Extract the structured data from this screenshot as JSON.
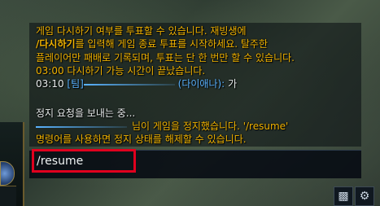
{
  "chat": {
    "lines": [
      {
        "text": "게임 다시하기 여부를 투표할 수 있습니다. 재빙생에"
      },
      {
        "cmd": "/다시하기",
        "text": "를 입력해 게임 종료 투표를 시작하세요. 탈주한"
      },
      {
        "text": "플레이어만 패배로 기록되며, 투표는 단 한 번만 할 수 있습니다."
      },
      {
        "text": "03:00 다시하기 가능 시간이 끝났습니다."
      },
      {
        "time": "03:10",
        "channel": "[팀]",
        "champion": "(다이애나):",
        "message": "가"
      },
      {
        "text": "정지 요청을 보내는 중..."
      },
      {
        "text": "님이 게임을 정지했습니다. '/resume'"
      },
      {
        "text": "명령어를 사용하면 정지 상태를 해제할 수 있습니다."
      }
    ]
  },
  "input": {
    "value": "/resume"
  },
  "icons": {
    "camera": "camera-icon",
    "settings": "gear-icon"
  },
  "colors": {
    "system": "#f0b200",
    "team": "#5ab3ff",
    "highlight_box": "#e0001e"
  }
}
